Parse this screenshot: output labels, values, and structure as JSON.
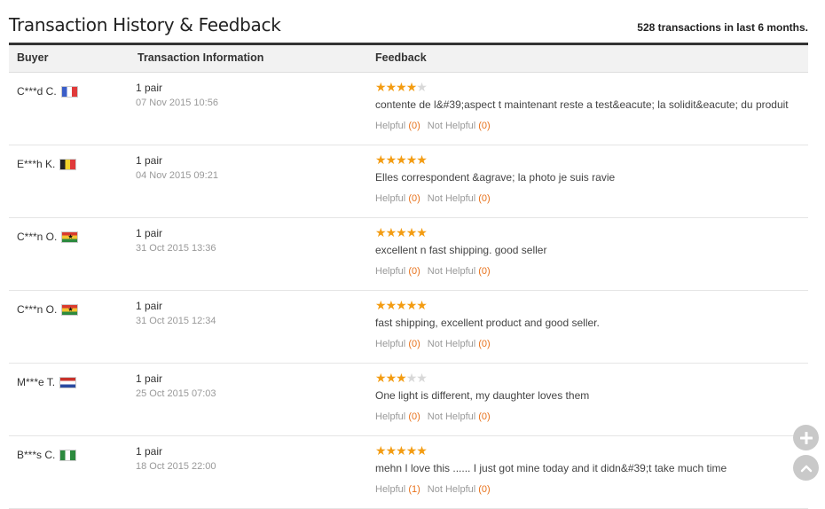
{
  "header": {
    "title": "Transaction History & Feedback",
    "summary": "528 transactions in last 6 months."
  },
  "columns": {
    "buyer": "Buyer",
    "transaction": "Transaction Information",
    "feedback": "Feedback"
  },
  "labels": {
    "helpful": "Helpful",
    "not_helpful": "Not Helpful"
  },
  "rows": [
    {
      "buyer": "C***d C.",
      "flag": "flag-fr",
      "qty": "1 pair",
      "date": "07 Nov 2015 10:56",
      "rating": 4,
      "comment": "contente de l&#39;aspect t maintenant reste a test&eacute; la solidit&eacute; du produit",
      "helpful": "(0)",
      "not_helpful": "(0)"
    },
    {
      "buyer": "E***h K.",
      "flag": "flag-be",
      "qty": "1 pair",
      "date": "04 Nov 2015 09:21",
      "rating": 5,
      "comment": "Elles correspondent &agrave; la photo je suis ravie",
      "helpful": "(0)",
      "not_helpful": "(0)"
    },
    {
      "buyer": "C***n O.",
      "flag": "flag-gh",
      "qty": "1 pair",
      "date": "31 Oct 2015 13:36",
      "rating": 5,
      "comment": "excellent n fast shipping. good seller",
      "helpful": "(0)",
      "not_helpful": "(0)"
    },
    {
      "buyer": "C***n O.",
      "flag": "flag-gh",
      "qty": "1 pair",
      "date": "31 Oct 2015 12:34",
      "rating": 5,
      "comment": "fast shipping, excellent product and good seller.",
      "helpful": "(0)",
      "not_helpful": "(0)"
    },
    {
      "buyer": "M***e T.",
      "flag": "flag-nl",
      "qty": "1 pair",
      "date": "25 Oct 2015 07:03",
      "rating": 3,
      "comment": "One light is different, my daughter loves them",
      "helpful": "(0)",
      "not_helpful": "(0)"
    },
    {
      "buyer": "B***s C.",
      "flag": "flag-ng",
      "qty": "1 pair",
      "date": "18 Oct 2015 22:00",
      "rating": 5,
      "comment": "mehn I love this ...... I just got mine today and it didn&#39;t take much time",
      "helpful": "(1)",
      "not_helpful": "(0)"
    }
  ],
  "floating": {
    "plus_icon": "plus-icon",
    "up_icon": "chevron-up-icon"
  }
}
